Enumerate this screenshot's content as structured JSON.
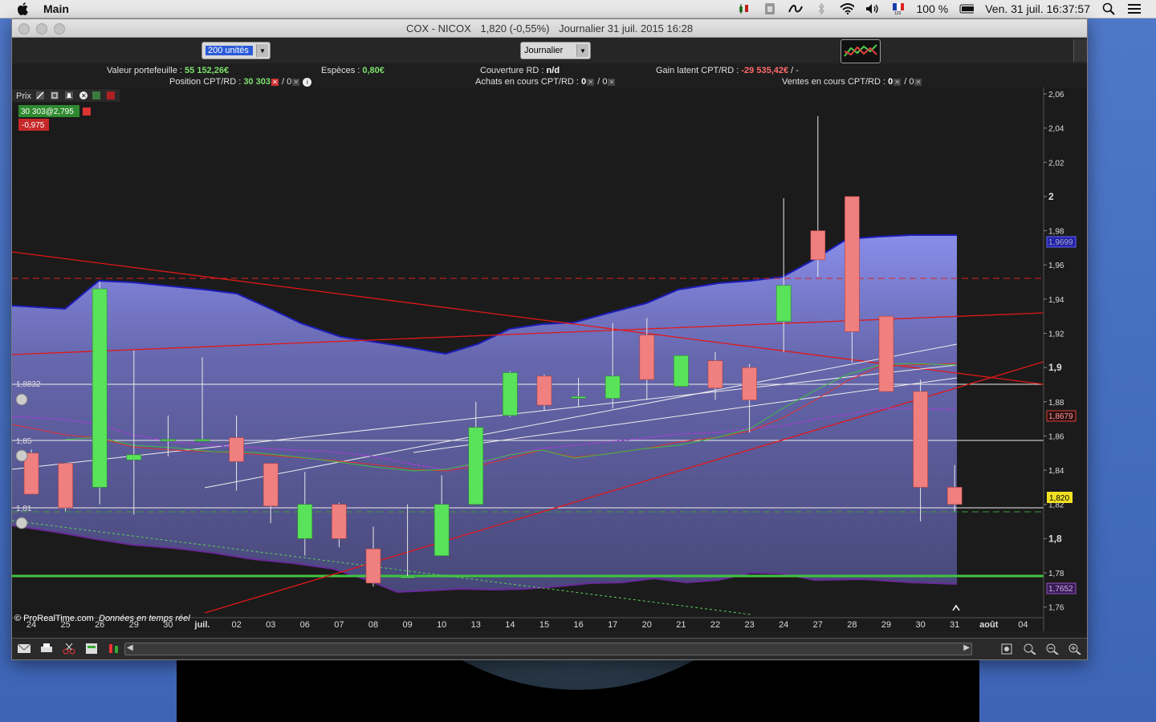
{
  "menubar": {
    "app_name": "Main",
    "battery": "100 %",
    "datetime": "Ven. 31 juil.  16:37:57"
  },
  "window": {
    "title_symbol": "COX - NICOX",
    "title_price": "1,820 (-0,55%)",
    "title_period": "Journalier  31 juil. 2015 16:28"
  },
  "toolbar": {
    "units_value": "200 unités",
    "period_value": "Journalier"
  },
  "info": {
    "portfolio_label": "Valeur portefeuille :",
    "portfolio_value": "55 152,26€",
    "cash_label": "Espèces :",
    "cash_value": "0,80€",
    "coverage_label": "Couverture RD :",
    "coverage_value": "n/d",
    "gain_label": "Gain latent CPT/RD :",
    "gain_value": "-29 535,42€",
    "gain_suffix": "/ -",
    "position_label": "Position CPT/RD :",
    "position_value": "30 303",
    "position_suffix": "/ 0",
    "buy_label": "Achats en cours CPT/RD :",
    "buy_value": "0",
    "buy_suffix": "/ 0",
    "sell_label": "Ventes en cours CPT/RD :",
    "sell_value": "0",
    "sell_suffix": "/ 0"
  },
  "chart": {
    "panel_label": "Prix",
    "position_badge": "30 303@2,795",
    "pnl_badge": "-0,975",
    "level_1": "1,8832",
    "level_2": "1,85",
    "level_3": "1,81",
    "watermark": "© ProRealTime.com",
    "realtime": "Données en temps réel",
    "tag_upper": "1,9699",
    "tag_mid": "1,8679",
    "tag_price": "1,820",
    "tag_lower": "1,7652",
    "colors": {
      "up": "#59e35a",
      "down": "#f07f7f",
      "band": "#8a8ef0",
      "trend_red": "#e01818",
      "support_green": "#3fc53f"
    }
  },
  "chart_data": {
    "type": "candlestick",
    "ylim": [
      1.75,
      2.06
    ],
    "y_ticks": [
      "2,06",
      "2,04",
      "2,02",
      "2",
      "1,98",
      "1,96",
      "1,94",
      "1,92",
      "1,9",
      "1,88",
      "1,86",
      "1,84",
      "1,82",
      "1,8",
      "1,78",
      "1,76"
    ],
    "x_labels": [
      "24",
      "25",
      "26",
      "29",
      "30",
      "juil.",
      "02",
      "03",
      "06",
      "07",
      "08",
      "09",
      "10",
      "13",
      "14",
      "15",
      "16",
      "17",
      "20",
      "21",
      "22",
      "23",
      "24",
      "27",
      "28",
      "29",
      "30",
      "31",
      "août",
      "04"
    ],
    "candles": [
      {
        "x": "24",
        "o": 1.85,
        "h": 1.852,
        "l": 1.826,
        "c": 1.826
      },
      {
        "x": "25",
        "o": 1.844,
        "h": 1.844,
        "l": 1.816,
        "c": 1.818
      },
      {
        "x": "26",
        "o": 1.83,
        "h": 1.95,
        "l": 1.82,
        "c": 1.946
      },
      {
        "x": "29",
        "o": 1.846,
        "h": 1.91,
        "l": 1.814,
        "c": 1.849
      },
      {
        "x": "30",
        "o": 1.858,
        "h": 1.872,
        "l": 1.848,
        "c": 1.858
      },
      {
        "x": "juil.",
        "o": 1.858,
        "h": 1.906,
        "l": 1.858,
        "c": 1.858
      },
      {
        "x": "02",
        "o": 1.859,
        "h": 1.872,
        "l": 1.828,
        "c": 1.845
      },
      {
        "x": "03",
        "o": 1.844,
        "h": 1.844,
        "l": 1.809,
        "c": 1.819
      },
      {
        "x": "06",
        "o": 1.8,
        "h": 1.839,
        "l": 1.79,
        "c": 1.82
      },
      {
        "x": "07",
        "o": 1.82,
        "h": 1.821,
        "l": 1.795,
        "c": 1.8
      },
      {
        "x": "08",
        "o": 1.794,
        "h": 1.807,
        "l": 1.772,
        "c": 1.774
      },
      {
        "x": "09",
        "o": 1.778,
        "h": 1.82,
        "l": 1.778,
        "c": 1.778
      },
      {
        "x": "10",
        "o": 1.79,
        "h": 1.837,
        "l": 1.79,
        "c": 1.82
      },
      {
        "x": "13",
        "o": 1.82,
        "h": 1.88,
        "l": 1.82,
        "c": 1.865
      },
      {
        "x": "14",
        "o": 1.872,
        "h": 1.898,
        "l": 1.871,
        "c": 1.897
      },
      {
        "x": "15",
        "o": 1.895,
        "h": 1.896,
        "l": 1.875,
        "c": 1.878
      },
      {
        "x": "16",
        "o": 1.883,
        "h": 1.894,
        "l": 1.877,
        "c": 1.883
      },
      {
        "x": "17",
        "o": 1.882,
        "h": 1.926,
        "l": 1.876,
        "c": 1.895
      },
      {
        "x": "20",
        "o": 1.919,
        "h": 1.929,
        "l": 1.881,
        "c": 1.893
      },
      {
        "x": "21",
        "o": 1.889,
        "h": 1.907,
        "l": 1.889,
        "c": 1.907
      },
      {
        "x": "22",
        "o": 1.904,
        "h": 1.909,
        "l": 1.881,
        "c": 1.888
      },
      {
        "x": "23",
        "o": 1.9,
        "h": 1.902,
        "l": 1.862,
        "c": 1.881
      },
      {
        "x": "24",
        "o": 1.927,
        "h": 1.999,
        "l": 1.909,
        "c": 1.948
      },
      {
        "x": "27",
        "o": 1.98,
        "h": 2.047,
        "l": 1.953,
        "c": 1.963
      },
      {
        "x": "28",
        "o": 2.0,
        "h": 2.0,
        "l": 1.903,
        "c": 1.921
      },
      {
        "x": "29",
        "o": 1.93,
        "h": 1.93,
        "l": 1.886,
        "c": 1.886
      },
      {
        "x": "30",
        "o": 1.886,
        "h": 1.893,
        "l": 1.81,
        "c": 1.83
      },
      {
        "x": "31",
        "o": 1.83,
        "h": 1.843,
        "l": 1.816,
        "c": 1.82
      }
    ]
  }
}
